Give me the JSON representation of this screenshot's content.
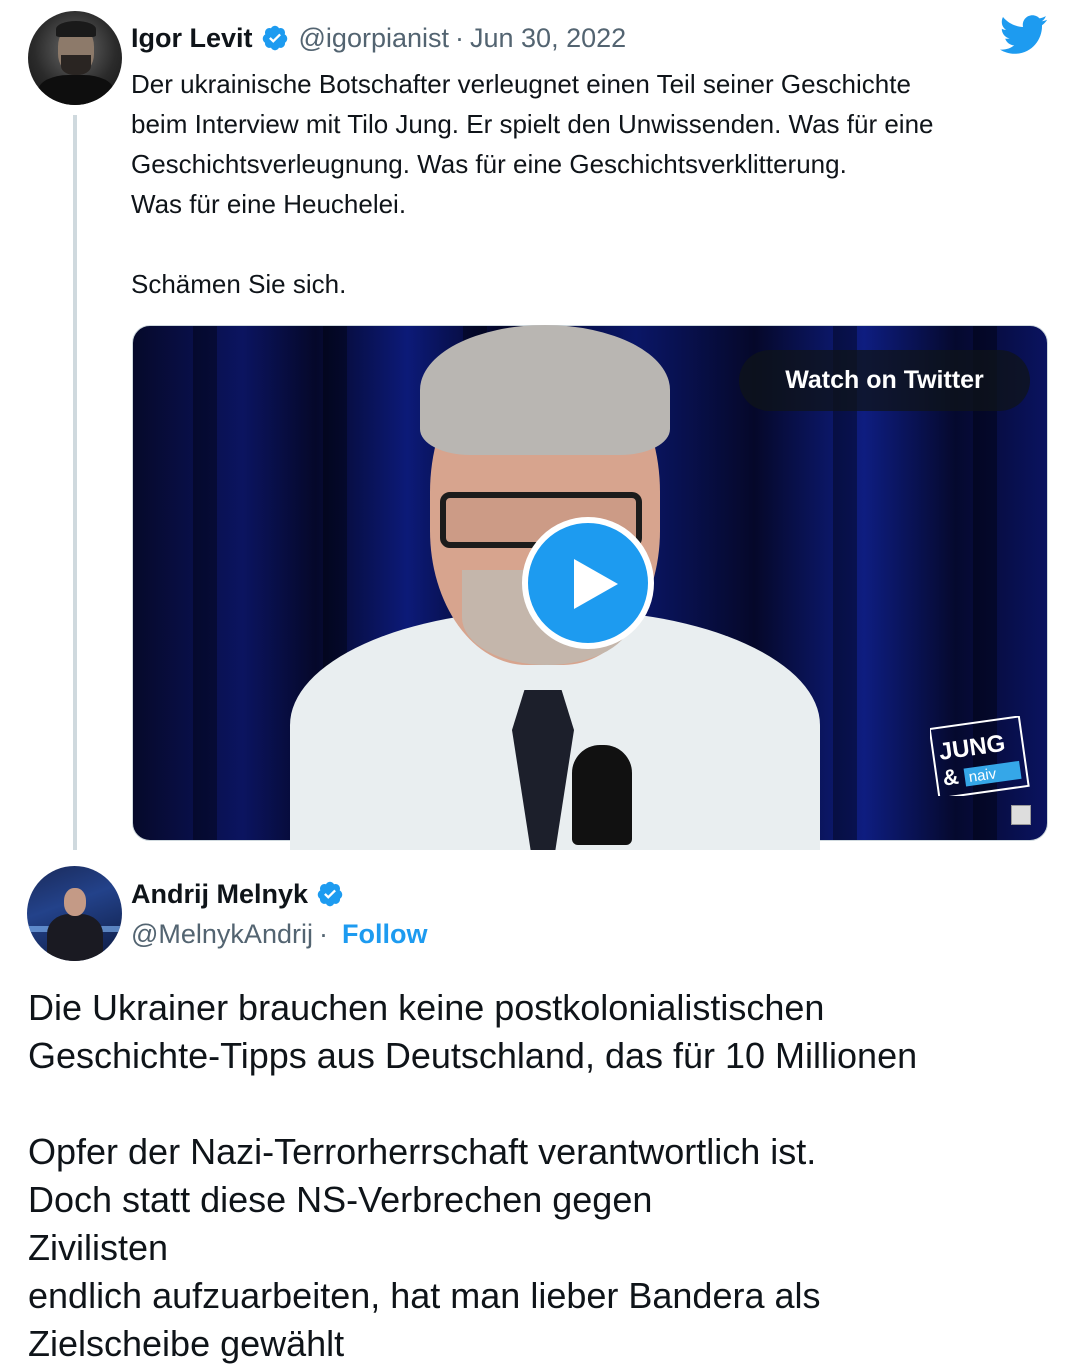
{
  "tweet1": {
    "name": "Igor Levit",
    "handle": "@igorpianist",
    "separator": "·",
    "date": "Jun 30, 2022",
    "text_lines": [
      "Der ukrainische Botschafter verleugnet einen Teil seiner Geschichte",
      "beim Interview mit Tilo Jung. Er spielt den Unwissenden. Was für eine",
      "Geschichtsverleugnung. Was für eine Geschichtsverklitterung.",
      "Was für eine Heuchelei.",
      "",
      "Schämen Sie sich."
    ],
    "video": {
      "watch_label": "Watch on Twitter",
      "logo_line1": "JUNG",
      "logo_line2": "&",
      "logo_line3": "naiv"
    }
  },
  "tweet2": {
    "name": "Andrij Melnyk",
    "handle": "@MelnykAndrij",
    "separator": "·",
    "follow_label": "Follow",
    "text": {
      "line1": "Die Ukrainer brauchen keine postkolonialistischen",
      "line2": "Geschichte-Tipps aus Deutschland, das für 10 Millionen",
      "line3": "Opfer der Nazi-Terrorherrschaft verantwortlich ist.",
      "line4a": "Doch statt diese NS-Verbrechen gegen ",
      "line4b": "Zivilisten",
      "line5": "endlich aufzuarbeiten, hat man lieber Bandera als",
      "line6": "Zielscheibe gewählt"
    }
  },
  "colors": {
    "twitter_blue": "#1d9bf0",
    "text": "#0f1419",
    "muted": "#536471",
    "flag_blue": "#1e63d6",
    "flag_yellow": "#f8d414"
  },
  "icons": [
    "verified-badge-icon",
    "twitter-bird-icon",
    "play-icon",
    "ukraine-flag-emoji"
  ]
}
